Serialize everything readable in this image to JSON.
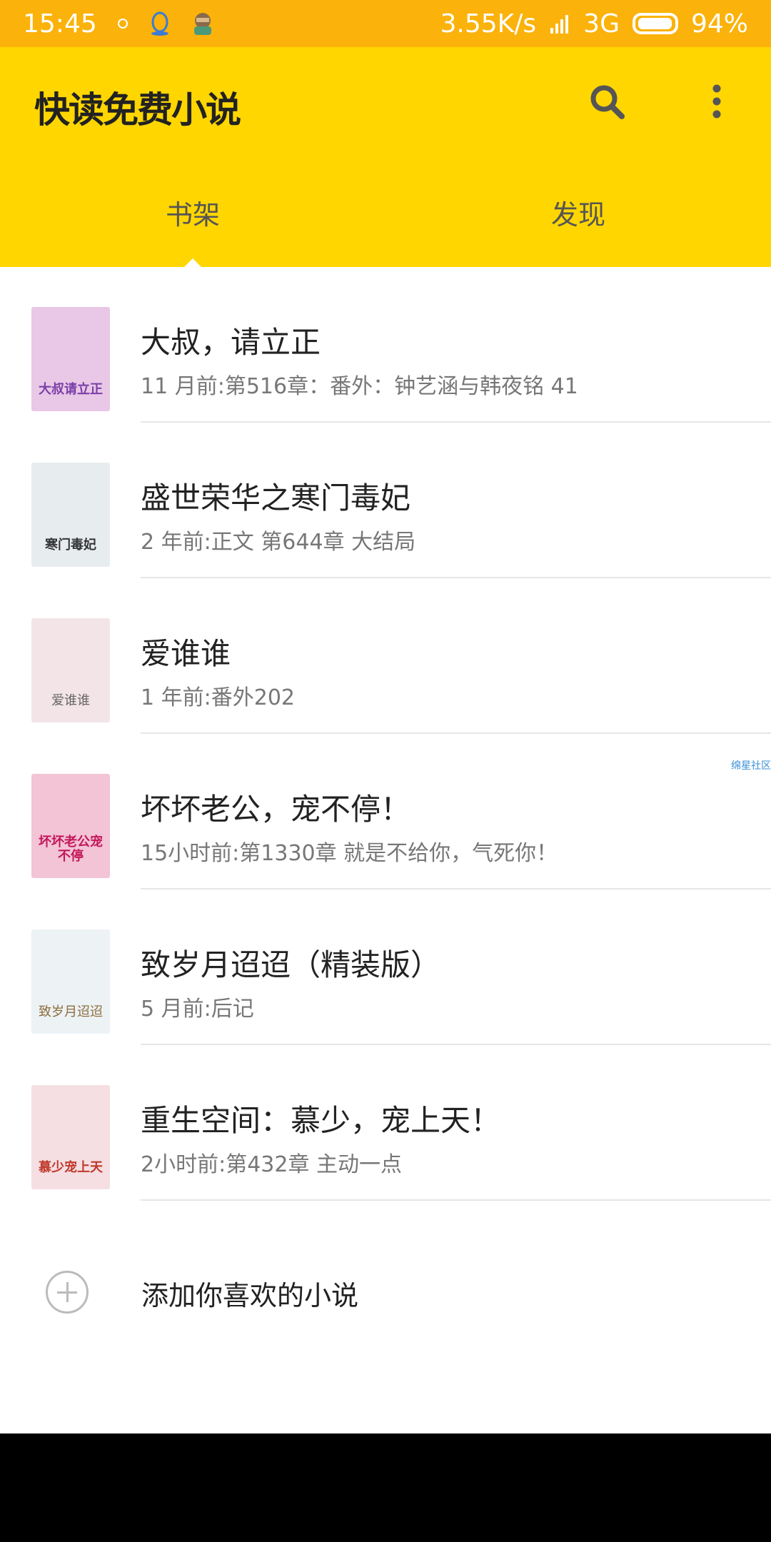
{
  "status_bar": {
    "time": "15:45",
    "speed": "3.55K/s",
    "network": "3G",
    "battery": "94%",
    "battery_level": 0.94
  },
  "app_bar": {
    "title": "快读免费小说",
    "tabs": [
      {
        "label": "书架",
        "selected": true
      },
      {
        "label": "发现",
        "selected": false
      }
    ]
  },
  "books": [
    {
      "title": "大叔，请立正",
      "subtitle": "11 月前:第516章：番外：钟艺涵与韩夜铭 41",
      "cover_text": "大叔请立正",
      "cover_color": "#e9c7e6"
    },
    {
      "title": "盛世荣华之寒门毒妃",
      "subtitle": "2 年前:正文 第644章 大结局",
      "cover_text": "寒门毒妃",
      "cover_color": "#e7ecef"
    },
    {
      "title": "爱谁谁",
      "subtitle": "1 年前:番外202",
      "cover_text": "爱谁谁",
      "cover_color": "#f3e4e7"
    },
    {
      "title": "坏坏老公，宠不停！",
      "subtitle": "15小时前:第1330章 就是不给你，气死你！",
      "cover_text": "坏坏老公宠不停",
      "cover_color": "#f3c3d6",
      "ad_tag": "绵星社区"
    },
    {
      "title": "致岁月迢迢（精装版）",
      "subtitle": "5 月前:后记",
      "cover_text": "致岁月迢迢",
      "cover_color": "#edf2f5"
    },
    {
      "title": "重生空间：慕少，宠上天！",
      "subtitle": "2小时前:第432章 主动一点",
      "cover_text": "慕少宠上天",
      "cover_color": "#f5dfe3"
    }
  ],
  "add_row": {
    "label": "添加你喜欢的小说"
  },
  "colors": {
    "status_bar": "#FBB20A",
    "app_bar": "#FFD600",
    "accent_text": "#222222"
  }
}
